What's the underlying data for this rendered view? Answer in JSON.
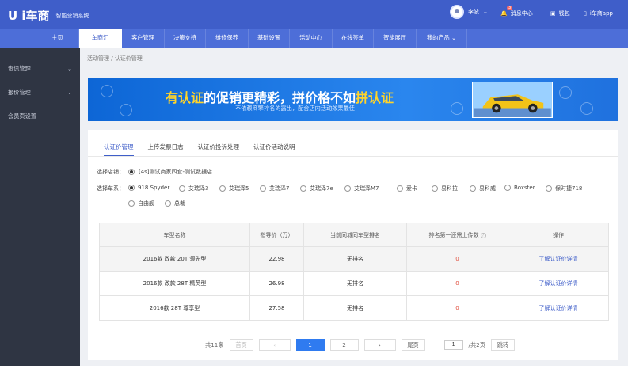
{
  "app": {
    "logo": "U i车商",
    "subtitle": "智能营销系统"
  },
  "topbar": {
    "user": "李波",
    "messages": "消息中心",
    "message_badge": "3",
    "wallet": "钱包",
    "app": "i车商app"
  },
  "nav": [
    {
      "label": "主页"
    },
    {
      "label": "车商汇"
    },
    {
      "label": "客户管理"
    },
    {
      "label": "决策支持"
    },
    {
      "label": "维修保养"
    },
    {
      "label": "基础设置"
    },
    {
      "label": "活动中心"
    },
    {
      "label": "在线签单"
    },
    {
      "label": "智能展厅"
    },
    {
      "label": "我的产品"
    }
  ],
  "sidebar": [
    {
      "label": "资讯管理"
    },
    {
      "label": "报价管理"
    },
    {
      "label": "会员页设置"
    }
  ],
  "breadcrumb": "活动管理 / 认证价管理",
  "banner": {
    "head_a": "有认证",
    "head_b": "的促销更精彩，拼价格不如",
    "head_c": "拼认证",
    "sub": "不依赖商擎排名的露出，配合店内活动效果最佳"
  },
  "tabs": [
    {
      "label": "认证价管理"
    },
    {
      "label": "上传发票日志"
    },
    {
      "label": "认证价投诉处理"
    },
    {
      "label": "认证价活动说明"
    }
  ],
  "store": {
    "label": "选择店铺：",
    "value": "[4s]测试商家四套-测试数据店"
  },
  "models_label": "选择车系：",
  "models": [
    {
      "label": "918 Spyder",
      "selected": true
    },
    {
      "label": "艾瑞泽3"
    },
    {
      "label": "艾瑞泽5"
    },
    {
      "label": "艾瑞泽7"
    },
    {
      "label": "艾瑞泽7e"
    },
    {
      "label": "艾瑞泽M7"
    },
    {
      "label": "爱卡"
    },
    {
      "label": "易科拉"
    },
    {
      "label": "易科威"
    },
    {
      "label": "Boxster"
    },
    {
      "label": "保时捷718"
    },
    {
      "label": "自由舰"
    },
    {
      "label": "总裁"
    }
  ],
  "table": {
    "headers": [
      "车型名称",
      "指导价（万）",
      "当前同城同车型排名",
      "排名第一还需上传数",
      "操作"
    ],
    "rows": [
      [
        "2016款 改款 20T 领先型",
        "22.98",
        "无排名",
        "0",
        "了解认证价详情"
      ],
      [
        "2016款 改款 28T 精英型",
        "26.98",
        "无排名",
        "0",
        "了解认证价详情"
      ],
      [
        "2016款 28T 尊享型",
        "27.58",
        "无排名",
        "0",
        "了解认证价详情"
      ]
    ]
  },
  "pager": {
    "total": "共11条",
    "first": "首页",
    "page1": "1",
    "page2": "2",
    "last": "尾页",
    "jump_value": "1",
    "pages": "/共2页",
    "go": "跳转"
  },
  "colors": {
    "topbar": "#3f5ec9",
    "nav": "#4d6ed8",
    "sidebar": "#2f3543",
    "accent": "#2f7bf0",
    "zero": "#e04b3a"
  }
}
